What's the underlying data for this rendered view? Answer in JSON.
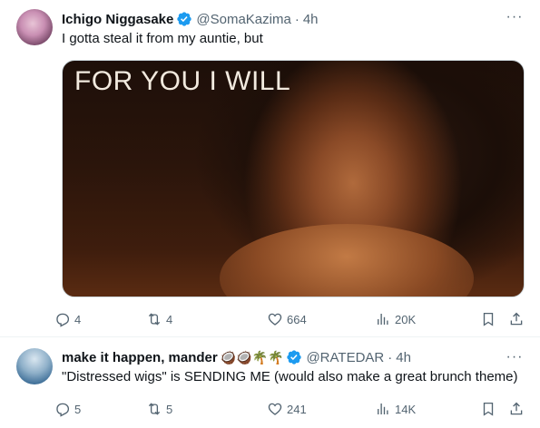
{
  "tweets": [
    {
      "author_name": "Ichigo Niggasake",
      "handle": "@SomaKazima",
      "separator": "·",
      "time": "4h",
      "text": "I gotta steal it from my auntie, but",
      "media_caption": "FOR YOU I WILL",
      "more": "···",
      "stats": {
        "replies": "4",
        "retweets": "4",
        "likes": "664",
        "views": "20K"
      }
    },
    {
      "author_name": "make it happen, mander",
      "name_emoji": "🥥🥥🌴🌴",
      "handle": "@RATEDAR",
      "separator": "·",
      "time": "4h",
      "text": "\"Distressed wigs\" is SENDING ME (would also make a great brunch theme)",
      "more": "···",
      "stats": {
        "replies": "5",
        "retweets": "5",
        "likes": "241",
        "views": "14K"
      }
    }
  ],
  "colors": {
    "verified": "#1d9bf0",
    "secondary_text": "#536471",
    "primary_text": "#0f1419",
    "divider": "#eff3f4"
  },
  "icons": [
    "avatar",
    "verified-badge-icon",
    "more-icon",
    "reply-icon",
    "retweet-icon",
    "like-icon",
    "views-icon",
    "bookmark-icon",
    "share-icon"
  ]
}
